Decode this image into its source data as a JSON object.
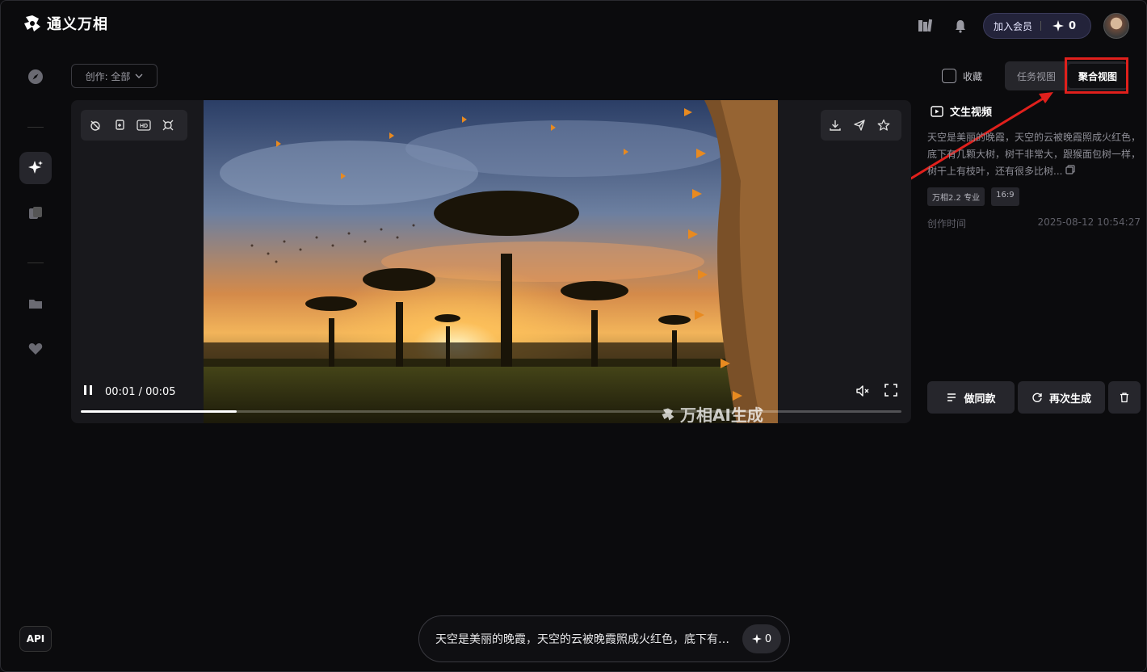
{
  "app": {
    "name": "通义万相"
  },
  "header": {
    "member_label": "加入会员",
    "credits": "0"
  },
  "sidebar": {
    "api_label": "API"
  },
  "filter": {
    "label": "创作: 全部"
  },
  "view": {
    "favorite_label": "收藏",
    "task_view": "任务视图",
    "aggregate_view": "聚合视图"
  },
  "player": {
    "current_time": "00:01",
    "total_time": "00:05",
    "time_display": "00:01 / 00:05",
    "progress": 0.19,
    "watermark": "万相AI生成"
  },
  "detail": {
    "type_title": "文生视频",
    "prompt": "天空是美丽的晚霞，天空的云被晚霞照成火红色，底下有几颗大树，树干非常大，跟猴面包树一样，树干上有枝叶，还有很多比树...",
    "tags": [
      "万相2.2 专业",
      "16:9"
    ],
    "created_label": "创作时间",
    "created_value": "2025-08-12 10:54:27"
  },
  "actions": {
    "same_style": "做同款",
    "regenerate": "再次生成"
  },
  "bottom": {
    "prompt": "天空是美丽的晚霞，天空的云被晚霞照成火红色，底下有几颗大树，树干非常大",
    "credits": "0"
  },
  "colors": {
    "highlight": "#e0201c",
    "background": "#0b0b0d",
    "card": "#18181c"
  }
}
